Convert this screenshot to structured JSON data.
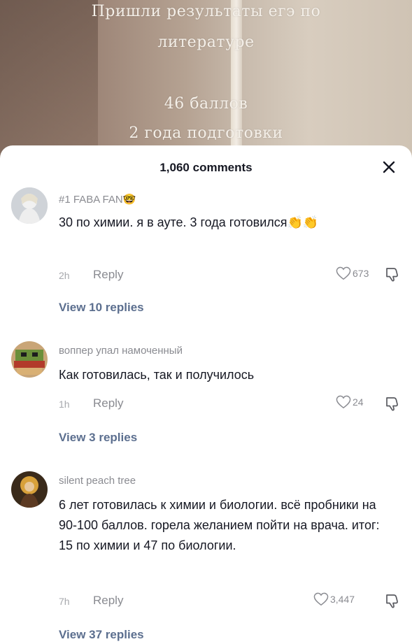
{
  "video": {
    "caption_lines": [
      "Пришли результаты егэ по",
      "литературе",
      "",
      "46 баллов",
      "2 года подготовки"
    ]
  },
  "sheet": {
    "title": "1,060 comments",
    "close_icon": "close-icon"
  },
  "comments": [
    {
      "username": "#1 FABA FAN🤓",
      "text": "30 по химии. я в ауте. 3 года готовился👏👏",
      "time": "2h",
      "reply": "Reply",
      "likes": "673",
      "view_replies": "View 10 replies"
    },
    {
      "username": "воппер упал намоченный",
      "text": "Как готовилась, так и получилось",
      "time": "1h",
      "reply": "Reply",
      "likes": "24",
      "view_replies": "View 3 replies"
    },
    {
      "username": "silent peach tree",
      "text": "6 лет готовилась к химии и биологии. всё пробники на 90-100 баллов. горела желанием пойти на врача. итог: 15 по химии и 47 по биологии.",
      "time": "7h",
      "reply": "Reply",
      "likes": "3,447",
      "view_replies": "View 37 replies"
    }
  ],
  "colors": {
    "text": "#161823",
    "muted": "#8a8b91",
    "link": "#5c6f8f"
  }
}
